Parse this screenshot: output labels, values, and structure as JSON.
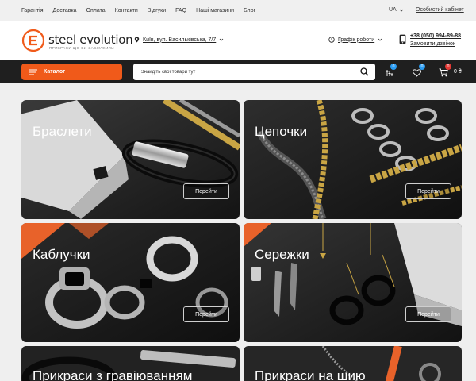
{
  "topbar": {
    "links": [
      "Гарантія",
      "Доставка",
      "Оплата",
      "Контакти",
      "Відгуки",
      "FAQ",
      "Наші магазини",
      "Блог"
    ],
    "language": "UA",
    "cabinet": "Особистий кабінет"
  },
  "header": {
    "logo_word": "steel evolution",
    "logo_tagline": "ПРИКРАСИ ЩО ВИ ЗАСЛУЖИЛИ",
    "address": "Київ, вул. Васильківська, 7/7",
    "schedule": "Графік роботи",
    "phone": "+38 (050) 994-89-88",
    "callback": "Замовити дзвінок"
  },
  "navbar": {
    "catalog_label": "Каталог",
    "search_placeholder": "Знайдіть свої товари тут",
    "compare_count": "0",
    "wishlist_count": "0",
    "cart_count": "0",
    "cart_total": "0 ₴"
  },
  "categories": [
    {
      "title": "Браслети",
      "button": "Перейти"
    },
    {
      "title": "Цепочки",
      "button": "Перейти"
    },
    {
      "title": "Каблучки",
      "button": "Перейти"
    },
    {
      "title": "Сережки",
      "button": "Перейти"
    },
    {
      "title": "Прикраси з гравіюванням",
      "button": ""
    },
    {
      "title": "Прикраси на шию",
      "button": ""
    }
  ],
  "colors": {
    "accent": "#f05a1a",
    "dark": "#1f1f1f",
    "badge_blue": "#2a9df4",
    "badge_red": "#e53935"
  }
}
